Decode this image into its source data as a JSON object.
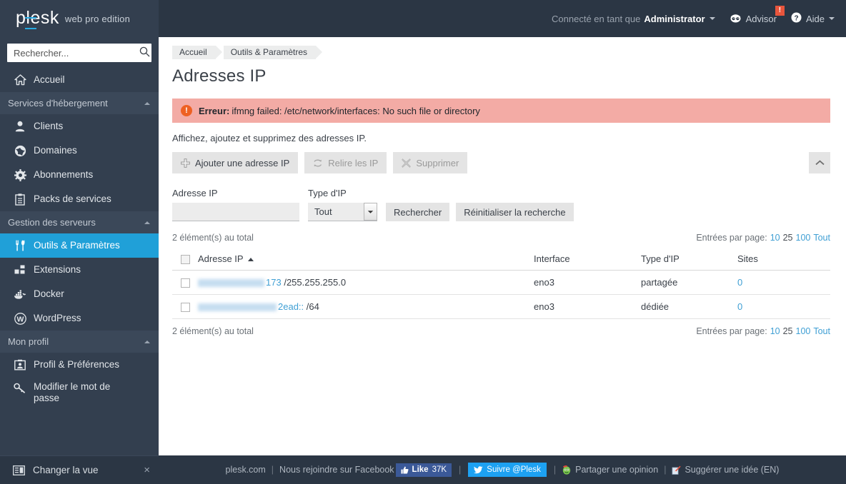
{
  "header": {
    "logo_text": "plesk",
    "edition": "web pro edition",
    "logged_in_label": "Connecté en tant que",
    "admin_name": "Administrator",
    "advisor_label": "Advisor",
    "advisor_badge": "!",
    "help_label": "Aide"
  },
  "sidebar": {
    "search_placeholder": "Rechercher...",
    "home": {
      "label": "Accueil",
      "icon": "home-icon"
    },
    "groups": [
      {
        "title": "Services d'hébergement",
        "items": [
          {
            "label": "Clients",
            "icon": "user-icon"
          },
          {
            "label": "Domaines",
            "icon": "globe-icon"
          },
          {
            "label": "Abonnements",
            "icon": "gear-icon"
          },
          {
            "label": "Packs de services",
            "icon": "clipboard-icon"
          }
        ]
      },
      {
        "title": "Gestion des serveurs",
        "items": [
          {
            "label": "Outils & Paramètres",
            "icon": "tools-icon",
            "active": true
          },
          {
            "label": "Extensions",
            "icon": "blocks-icon"
          },
          {
            "label": "Docker",
            "icon": "docker-icon"
          },
          {
            "label": "WordPress",
            "icon": "wordpress-icon"
          }
        ]
      },
      {
        "title": "Mon profil",
        "items": [
          {
            "label": "Profil & Préférences",
            "icon": "profile-icon"
          },
          {
            "label": "Modifier le mot de passe",
            "icon": "key-icon"
          }
        ]
      }
    ],
    "change_view": {
      "label": "Changer la vue",
      "close": "×"
    }
  },
  "breadcrumb": [
    {
      "label": "Accueil"
    },
    {
      "label": "Outils & Paramètres"
    }
  ],
  "page": {
    "title": "Adresses IP",
    "description": "Affichez, ajoutez et supprimez des adresses IP."
  },
  "alert": {
    "icon_glyph": "!",
    "bold": "Erreur:",
    "message": "ifmng failed: /etc/network/interfaces: No such file or directory"
  },
  "toolbar": {
    "add_label": "Ajouter une adresse IP",
    "reread_label": "Relire les IP",
    "remove_label": "Supprimer",
    "collapse_icon": "chevron-up-icon"
  },
  "filter": {
    "ip_label": "Adresse IP",
    "ip_value": "",
    "ip_placeholder": "",
    "type_label": "Type d'IP",
    "type_value": "Tout",
    "type_options": [
      "Tout"
    ],
    "search_label": "Rechercher",
    "reset_label": "Réinitialiser la recherche"
  },
  "list": {
    "total_text": "2 élément(s) au total",
    "per_page_label": "Entrées par page:",
    "per_page_options": [
      {
        "label": "10",
        "current": false
      },
      {
        "label": "25",
        "current": true
      },
      {
        "label": "100",
        "current": false
      },
      {
        "label": "Tout",
        "current": false
      }
    ],
    "columns": {
      "ip": "Adresse IP",
      "interface": "Interface",
      "type": "Type d'IP",
      "sites": "Sites"
    },
    "sort_column": "Adresse IP",
    "sort_direction": "asc",
    "rows": [
      {
        "ip_redacted_width": 93,
        "ip_suffix": "173",
        "ip_mask": "/255.255.255.0",
        "interface": "eno3",
        "type": "partagée",
        "sites": "0"
      },
      {
        "ip_redacted_width": 110,
        "ip_suffix": "2ead::",
        "ip_mask": "/64",
        "interface": "eno3",
        "type": "dédiée",
        "sites": "0"
      }
    ]
  },
  "footer": {
    "site": "plesk.com",
    "facebook_text": "Nous rejoindre sur Facebook",
    "like_label": "Like",
    "like_count": "37K",
    "twitter_label": "Suivre @Plesk",
    "share_opinion": "Partager une opinion",
    "suggest_idea": "Suggérer une idée (EN)",
    "separator": "|"
  },
  "colors": {
    "sidebar_bg": "#333f4f",
    "topbar_bg": "#2b3644",
    "accent": "#20a0d8",
    "link": "#3f9fd4",
    "error_bg": "#f3aba5",
    "error_icon": "#ee6123",
    "facebook": "#3b5998",
    "twitter": "#1da1f2"
  }
}
